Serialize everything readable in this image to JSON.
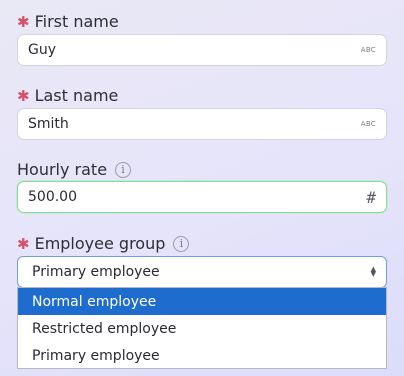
{
  "fields": {
    "first_name": {
      "label": "First name",
      "value": "Guy",
      "hint": "ABC",
      "required": "✱"
    },
    "last_name": {
      "label": "Last name",
      "value": "Smith",
      "hint": "ABC",
      "required": "✱"
    },
    "hourly_rate": {
      "label": "Hourly rate",
      "value": "500.00",
      "hint": "#",
      "info": "i"
    },
    "employee_group": {
      "label": "Employee group",
      "required": "✱",
      "info": "i",
      "value": "Primary employee",
      "options": [
        "Normal employee",
        "Restricted employee",
        "Primary employee"
      ],
      "highlighted": "Normal employee"
    }
  },
  "colors": {
    "required": "#d6506b",
    "focus_border": "#8fd3a5",
    "highlight": "#1f6ccf"
  }
}
